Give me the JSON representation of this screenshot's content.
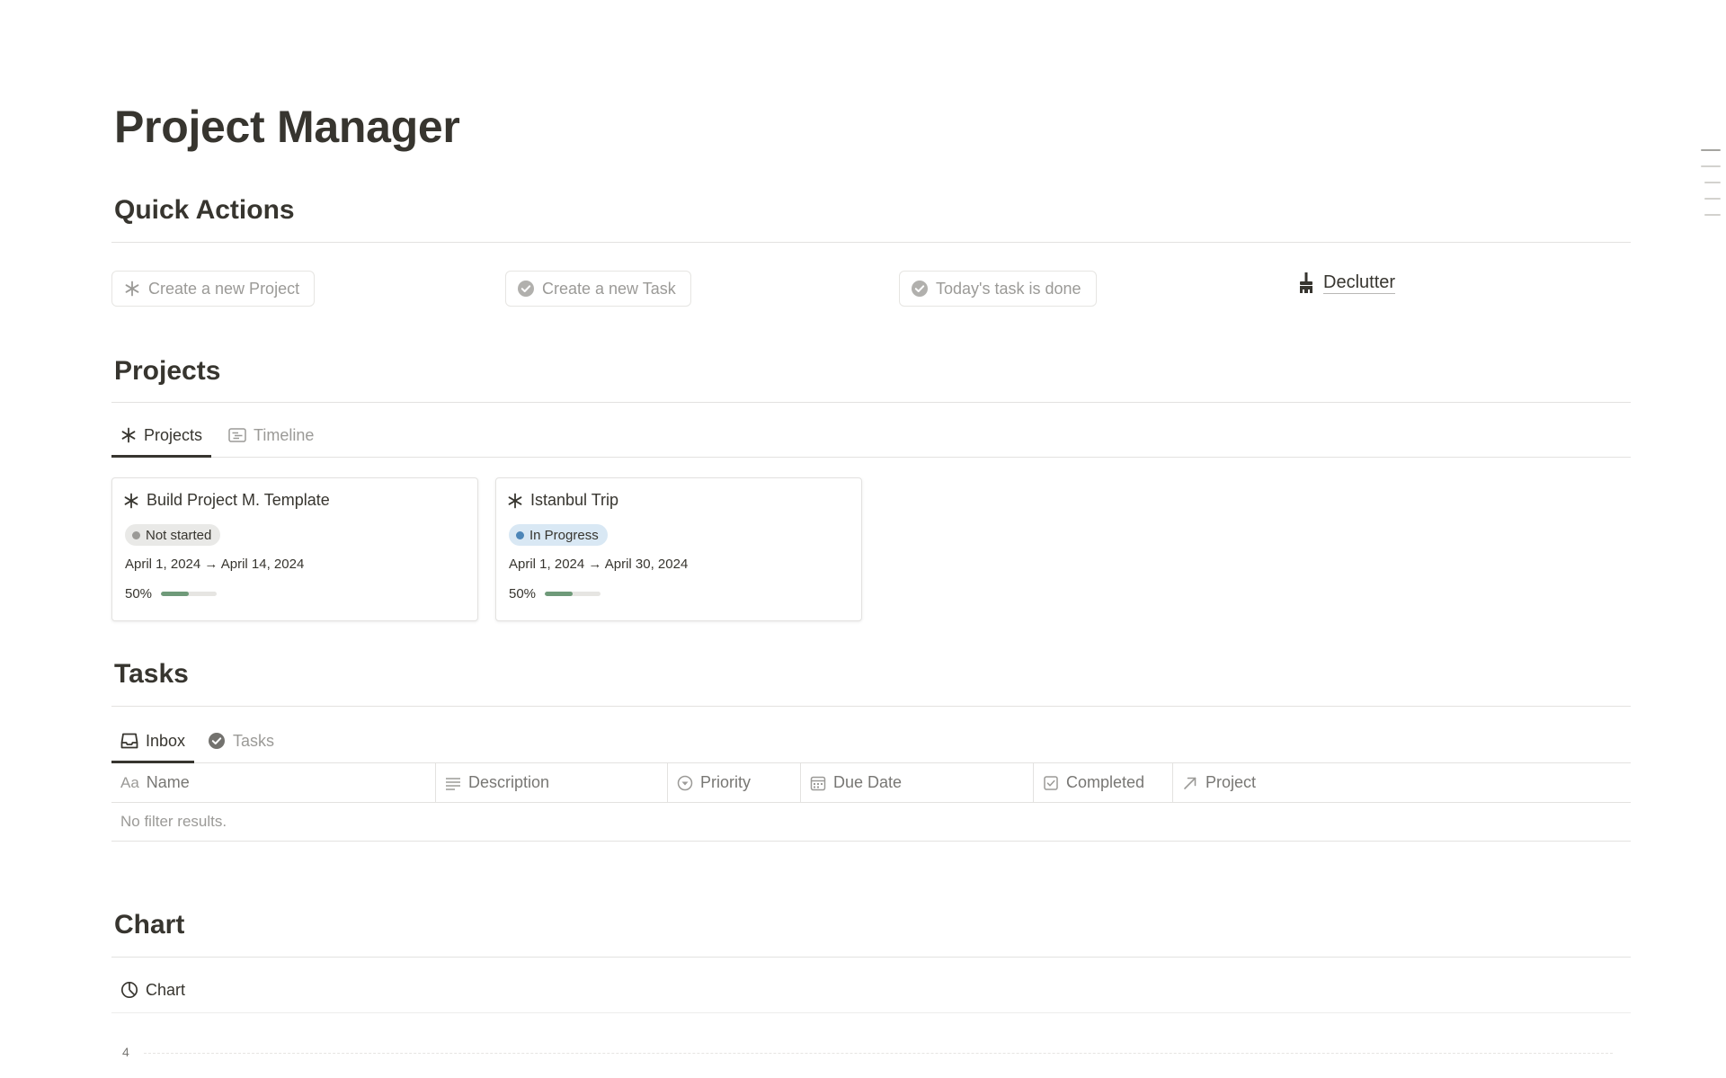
{
  "page": {
    "title": "Project Manager"
  },
  "quick_actions": {
    "heading": "Quick Actions",
    "buttons": [
      {
        "label": "Create a new Project",
        "icon": "asterisk-icon"
      },
      {
        "label": "Create a new Task",
        "icon": "check-circle-icon"
      },
      {
        "label": "Today's task is done",
        "icon": "check-circle-icon"
      }
    ],
    "declutter": {
      "label": "Declutter",
      "icon": "broom-icon"
    }
  },
  "projects": {
    "heading": "Projects",
    "tabs": [
      {
        "label": "Projects",
        "icon": "asterisk-icon",
        "active": true
      },
      {
        "label": "Timeline",
        "icon": "timeline-icon",
        "active": false
      }
    ],
    "cards": [
      {
        "title": "Build Project M. Template",
        "status": "Not started",
        "status_color": "#9b9a97",
        "status_bg": "#e9e9e7",
        "dates": "April 1, 2024 → April 14, 2024",
        "progress_label": "50%",
        "progress": 0.5,
        "progress_color": "#6f9a79"
      },
      {
        "title": "Istanbul Trip",
        "status": "In Progress",
        "status_color": "#4d86b8",
        "status_bg": "#d9e8f4",
        "dates": "April 1, 2024 → April 30, 2024",
        "progress_label": "50%",
        "progress": 0.5,
        "progress_color": "#6f9a79"
      }
    ]
  },
  "tasks": {
    "heading": "Tasks",
    "tabs": [
      {
        "label": "Inbox",
        "icon": "inbox-icon",
        "active": true
      },
      {
        "label": "Tasks",
        "icon": "check-circle-icon",
        "active": false
      }
    ],
    "columns": [
      {
        "label": "Name",
        "icon": "text-aa-icon"
      },
      {
        "label": "Description",
        "icon": "lines-icon"
      },
      {
        "label": "Priority",
        "icon": "select-circle-icon"
      },
      {
        "label": "Due Date",
        "icon": "calendar-icon"
      },
      {
        "label": "Completed",
        "icon": "checkbox-icon"
      },
      {
        "label": "Project",
        "icon": "relation-arrow-icon"
      }
    ],
    "empty_message": "No filter results."
  },
  "chart": {
    "heading": "Chart",
    "tab_label": "Chart",
    "tab_icon": "pie-chart-icon",
    "y_tick": "4"
  }
}
